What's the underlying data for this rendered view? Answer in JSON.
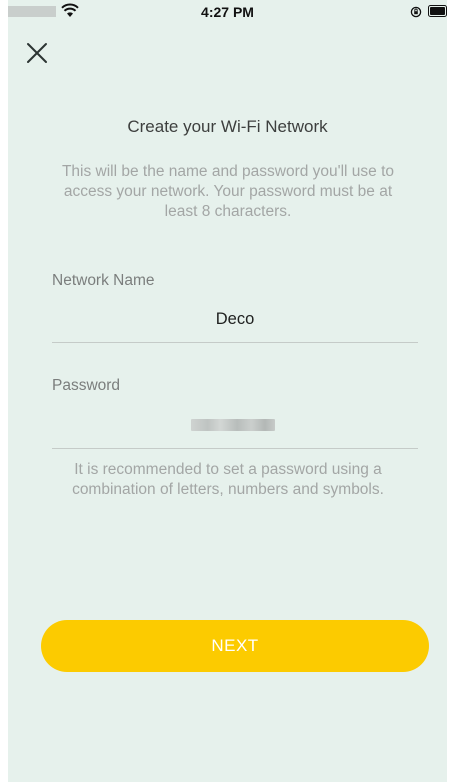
{
  "status_bar": {
    "time": "4:27 PM",
    "icons": [
      "wifi-icon",
      "rotation-lock-icon",
      "battery-icon"
    ]
  },
  "header": {
    "close_icon": "close-icon",
    "title": "Create your Wi-Fi Network"
  },
  "description": "This will be the name and password you'll use to access your network. Your password must be at least 8 characters.",
  "network_name": {
    "label": "Network Name",
    "value": "Deco"
  },
  "password": {
    "label": "Password"
  },
  "hint": "It is recommended to set a password using a combination of letters, numbers and symbols.",
  "next_button": {
    "label": "NEXT"
  },
  "colors": {
    "background": "#e6f1ec",
    "accent": "#fccb00",
    "button_text": "#ffffff"
  }
}
